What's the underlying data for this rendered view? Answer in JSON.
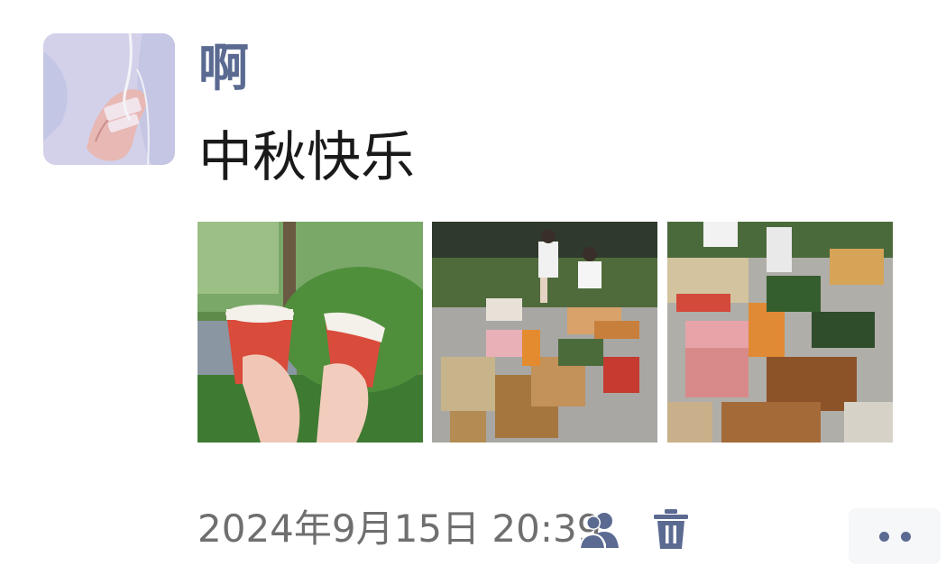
{
  "post": {
    "username": "啊",
    "text": "中秋快乐",
    "timestamp": "2024年9月15日 20:39"
  },
  "images": [
    {
      "description_icon": "photo-cups"
    },
    {
      "description_icon": "photo-party-table"
    },
    {
      "description_icon": "photo-food-trays"
    }
  ],
  "icons": {
    "avatar": "avatar-image",
    "visibility": "people-icon",
    "delete": "trash-icon",
    "more": "more-dots-icon"
  },
  "colors": {
    "username": "#5b6a91",
    "text": "#1a1a1a",
    "meta": "#6f6f6f",
    "accent_icon": "#5b6a91"
  }
}
